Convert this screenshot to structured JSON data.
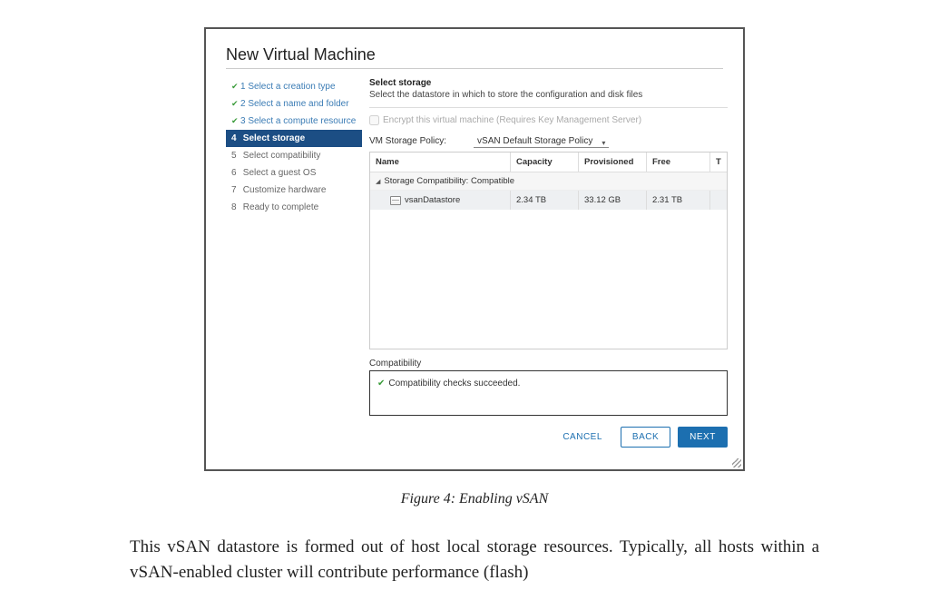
{
  "dialog": {
    "title": "New Virtual Machine"
  },
  "wizard": {
    "steps": [
      {
        "num": "1",
        "label": "Select a creation type",
        "state": "done"
      },
      {
        "num": "2",
        "label": "Select a name and folder",
        "state": "done"
      },
      {
        "num": "3",
        "label": "Select a compute resource",
        "state": "done"
      },
      {
        "num": "4",
        "label": "Select storage",
        "state": "current"
      },
      {
        "num": "5",
        "label": "Select compatibility",
        "state": "pending"
      },
      {
        "num": "6",
        "label": "Select a guest OS",
        "state": "pending"
      },
      {
        "num": "7",
        "label": "Customize hardware",
        "state": "pending"
      },
      {
        "num": "8",
        "label": "Ready to complete",
        "state": "pending"
      }
    ]
  },
  "main": {
    "heading": "Select storage",
    "subheading": "Select the datastore in which to store the configuration and disk files",
    "encrypt_label": "Encrypt this virtual machine (Requires Key Management Server)",
    "policy_label": "VM Storage Policy:",
    "policy_value": "vSAN Default Storage Policy",
    "columns": {
      "name": "Name",
      "capacity": "Capacity",
      "provisioned": "Provisioned",
      "free": "Free",
      "last": "T"
    },
    "group_label": "Storage Compatibility: Compatible",
    "rows": [
      {
        "name": "vsanDatastore",
        "capacity": "2.34 TB",
        "provisioned": "33.12 GB",
        "free": "2.31 TB"
      }
    ],
    "compat_heading": "Compatibility",
    "compat_msg": "Compatibility checks succeeded."
  },
  "buttons": {
    "cancel": "CANCEL",
    "back": "BACK",
    "next": "NEXT"
  },
  "caption": "Figure 4: Enabling vSAN",
  "paragraph": "This vSAN datastore is formed out of host local storage resources. Typically, all hosts within a vSAN-enabled cluster will contribute performance (flash)"
}
